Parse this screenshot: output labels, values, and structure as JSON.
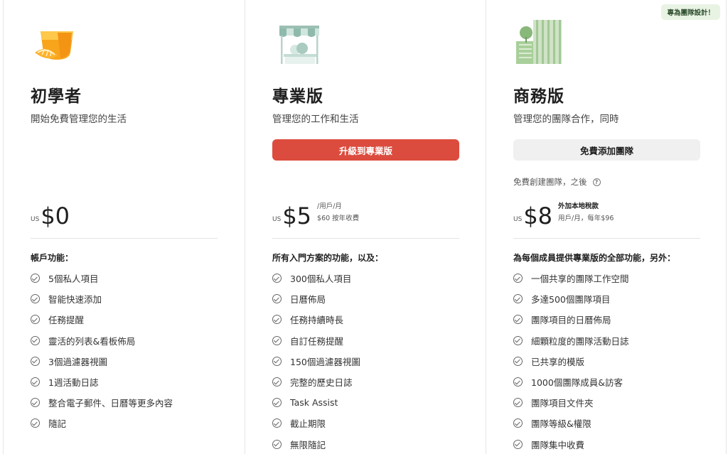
{
  "plans": [
    {
      "name": "初學者",
      "tagline": "開始免費管理您的生活",
      "currency": "US",
      "amount": "$0",
      "features_heading": "帳戶功能：",
      "features": [
        "5個私人項目",
        "智能快速添加",
        "任務提醒",
        "靈活的列表&看板佈局",
        "3個過濾器視圖",
        "1週活動日誌",
        "整合電子郵件、日曆等更多內容",
        "隨記"
      ],
      "icon": "orange-glass-icon"
    },
    {
      "name": "專業版",
      "tagline": "管理您的工作和生活",
      "cta": "升級到專業版",
      "currency": "US",
      "amount": "$5",
      "price_line1": "/用戶/月",
      "price_line2": "$60 按年收費",
      "features_heading": "所有入門方案的功能，以及：",
      "features": [
        "300個私人項目",
        "日曆佈局",
        "任務持續時長",
        "自訂任務提醒",
        "150個過濾器視圖",
        "完整的歷史日誌",
        "Task Assist",
        "截止期限",
        "無限隨記"
      ],
      "icon": "market-stall-icon"
    },
    {
      "name": "商務版",
      "tagline": "管理您的團隊合作，同時",
      "cta": "免費添加團隊",
      "badge": "專為團隊設計！",
      "free_note": "免費創建團隊，之後",
      "currency": "US",
      "amount": "$8",
      "price_line1": "外加本地稅款",
      "price_line2": "用戶/月，每年$96",
      "features_heading": "為每個成員提供專業版的全部功能，另外：",
      "features": [
        "一個共享的團隊工作空間",
        "多達500個團隊項目",
        "團隊項目的日曆佈局",
        "細顆粒度的團隊活動日誌",
        "已共享的模版",
        "1000個團隊成員&訪客",
        "團隊項目文件夾",
        "團隊等級&權限",
        "團隊集中收費"
      ],
      "icon": "office-building-icon"
    }
  ],
  "colors": {
    "accent_red": "#dc4c3e",
    "badge_green": "#e9f3e4"
  }
}
